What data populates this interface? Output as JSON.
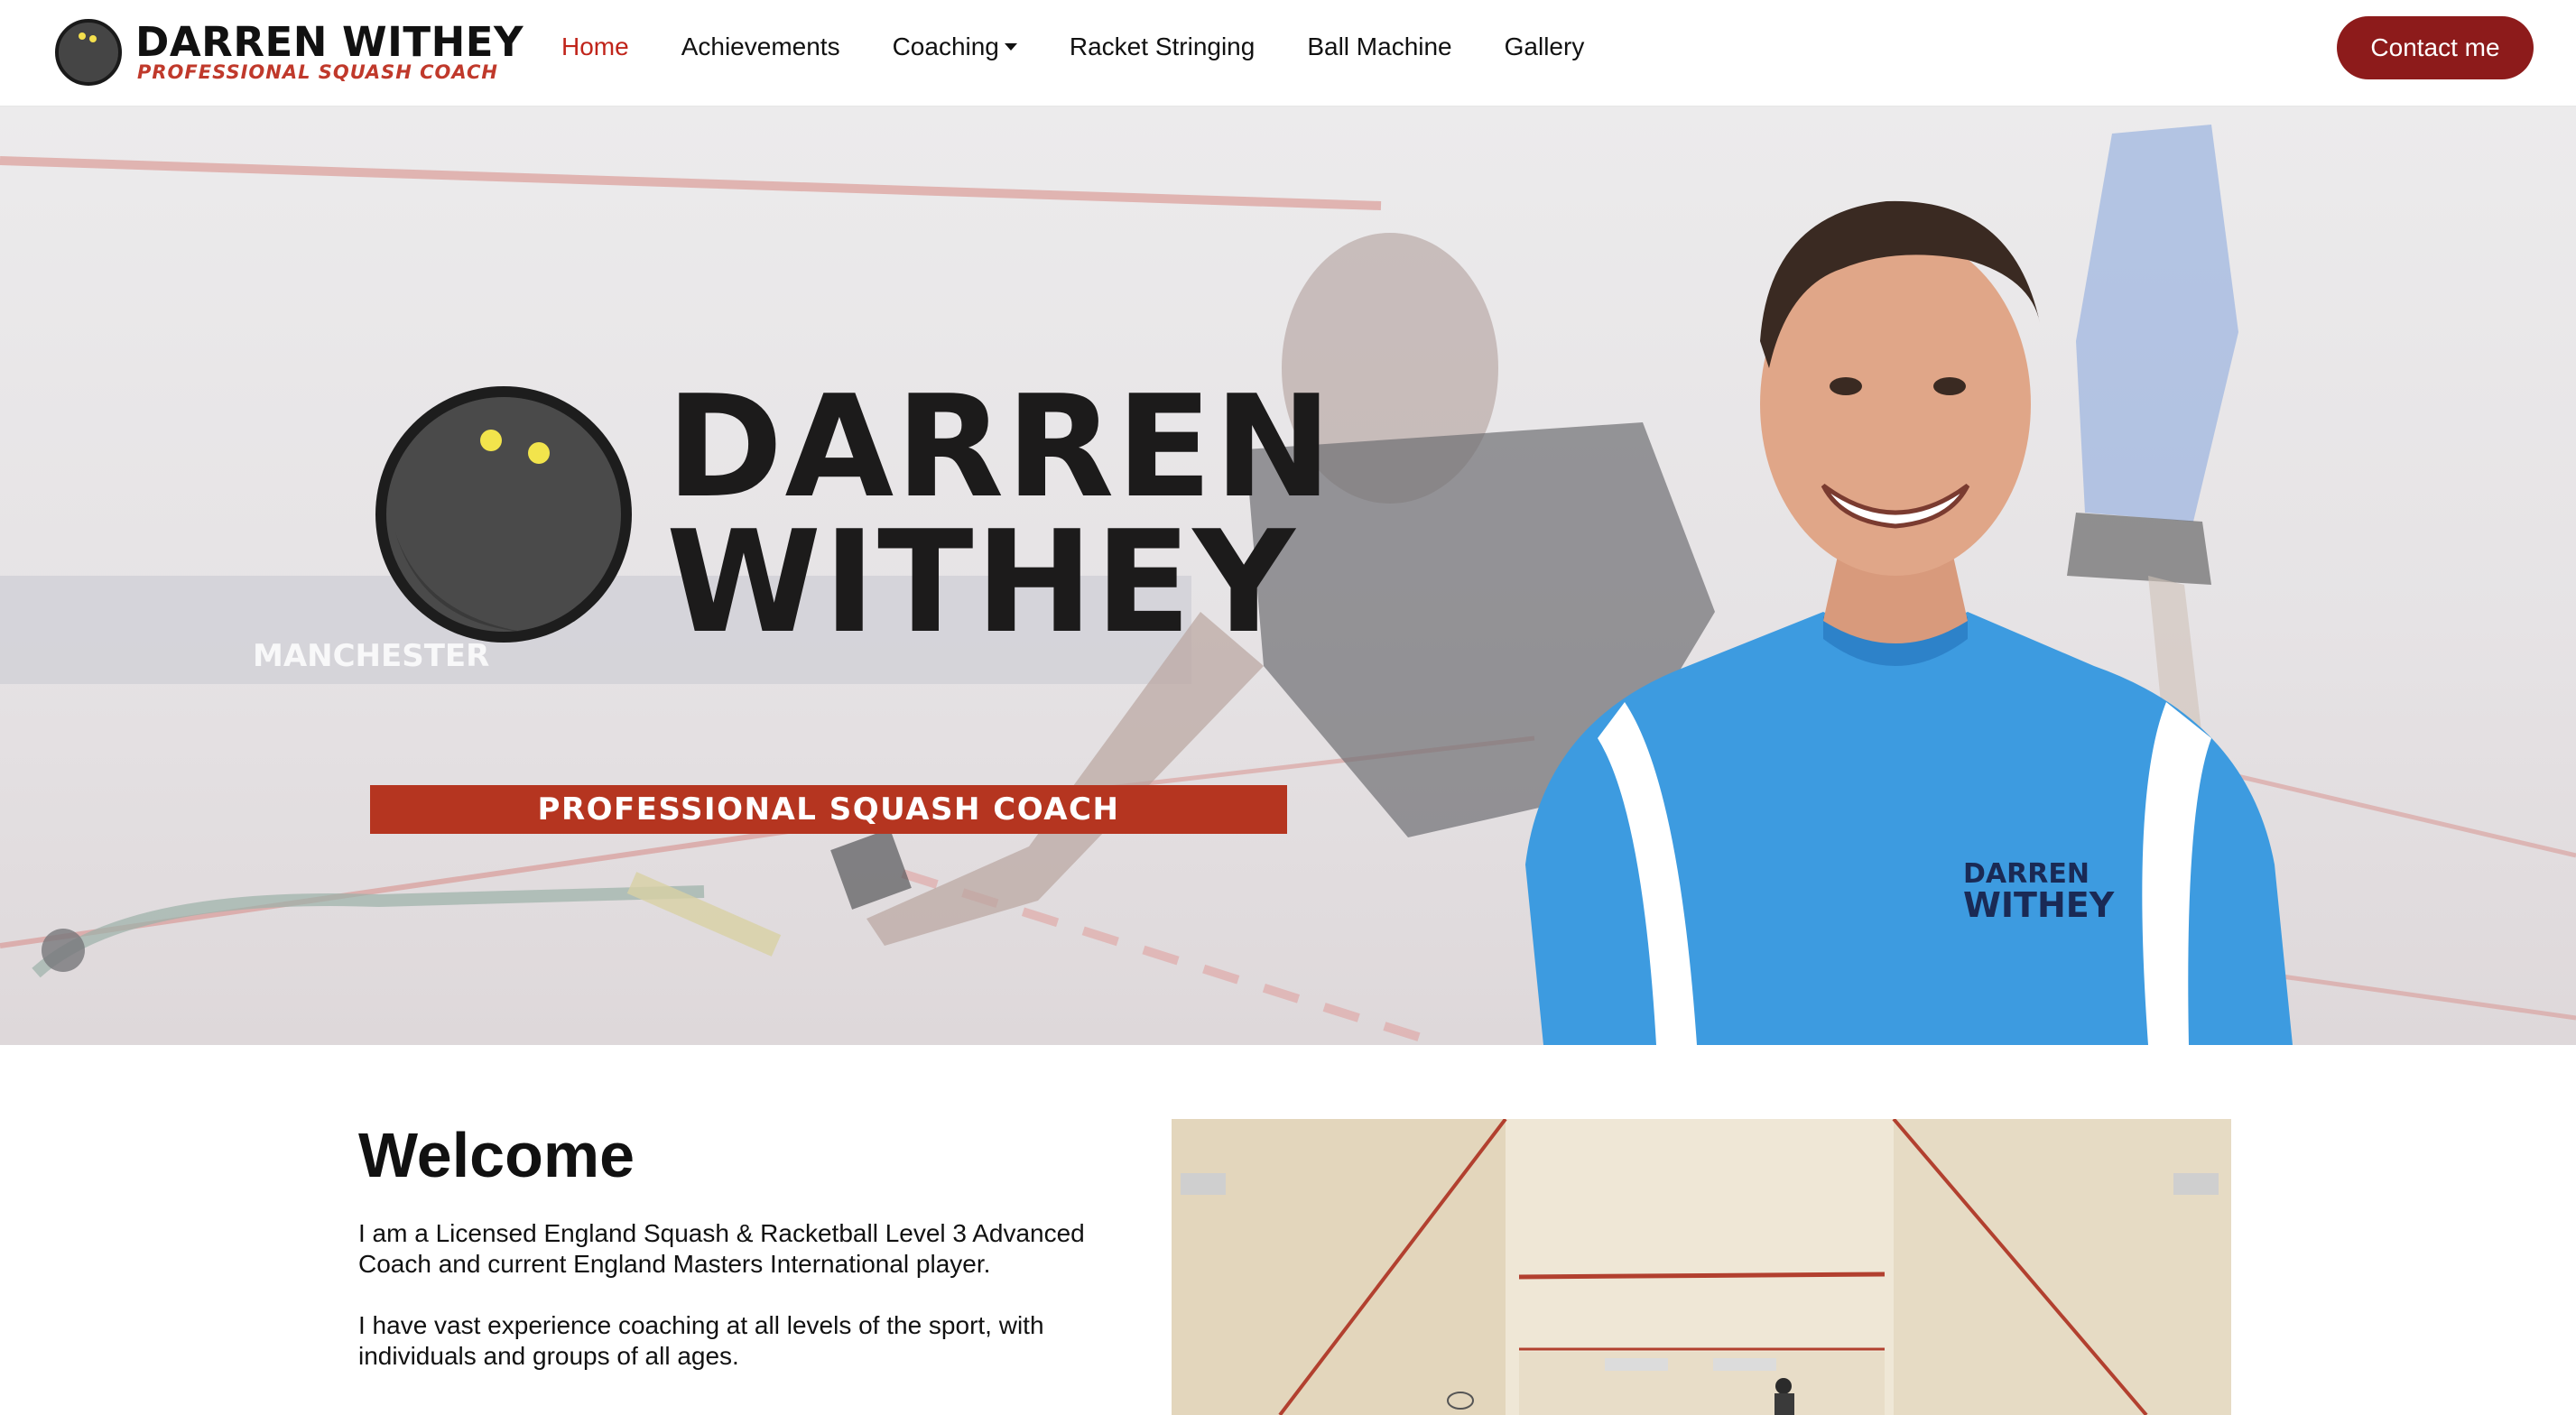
{
  "navbar": {
    "brand": {
      "name": "DARREN WITHEY",
      "tagline": "PROFESSIONAL SQUASH COACH"
    },
    "links": [
      {
        "label": "Home",
        "active": true
      },
      {
        "label": "Achievements"
      },
      {
        "label": "Coaching",
        "dropdown": true
      },
      {
        "label": "Racket Stringing"
      },
      {
        "label": "Ball Machine"
      },
      {
        "label": "Gallery"
      }
    ],
    "contact_label": "Contact me"
  },
  "hero": {
    "logo_line1": "DARREN",
    "logo_line2": "WITHEY",
    "banner": "PROFESSIONAL SQUASH COACH",
    "wall_text": "MANCHESTER",
    "shirt_logo_line1": "DARREN",
    "shirt_logo_line2": "WITHEY"
  },
  "welcome": {
    "title": "Welcome",
    "paragraphs": [
      "I am a Licensed England Squash & Racketball Level 3 Advanced Coach and current England Masters International player.",
      "I have vast experience coaching at all levels of the sport, with individuals and groups of all ages."
    ]
  },
  "colors": {
    "brand_red": "#c0241a",
    "button": "#8d1b1b",
    "banner": "#b53520",
    "shirt_blue": "#3d9be0"
  }
}
